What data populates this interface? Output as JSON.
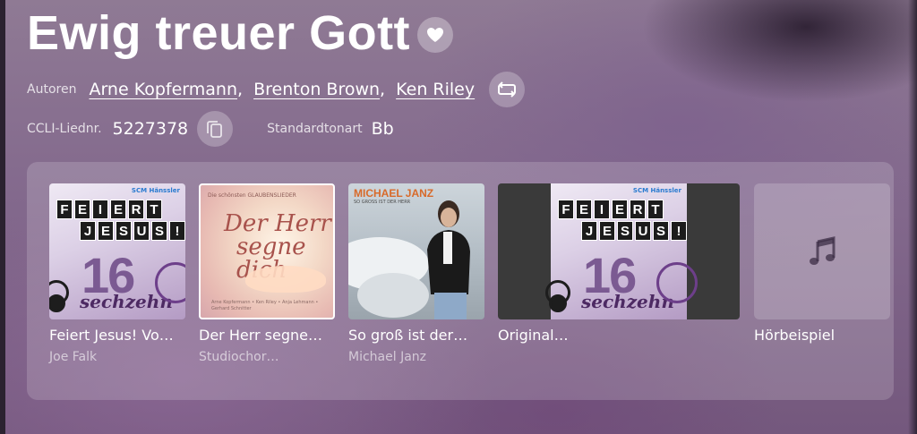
{
  "song": {
    "title": "Ewig treuer Gott",
    "authors_label": "Autoren",
    "authors": [
      "Arne Kopfermann",
      "Brenton Brown",
      "Ken Riley"
    ],
    "ccli_label": "CCLI-Liednr.",
    "ccli_number": "5227378",
    "key_label": "Standardtonart",
    "key_value": "Bb"
  },
  "recordings": [
    {
      "title": "Feiert Jesus! Vo…",
      "artist": "Joe Falk"
    },
    {
      "title": "Der Herr segne…",
      "artist": "Studiochor…"
    },
    {
      "title": "So groß ist der…",
      "artist": "Michael Janz"
    },
    {
      "title": "Original…",
      "artist": ""
    },
    {
      "title": "Hörbeispiel",
      "artist": ""
    }
  ],
  "covers": {
    "feiert_jesus": {
      "logo": "SCM Hänssler",
      "line1": "FEIERT",
      "line2": "JESUS!",
      "number": "16",
      "word": "sechzehn"
    },
    "der_herr": {
      "top": "Die schönsten GLAUBENSLIEDER",
      "script1": "Der Herr",
      "script2": "segne dich",
      "small": "Arne Kopfermann • Ken Riley • Anja Lehmann • Gerhard Schnitter"
    },
    "michael_janz": {
      "name": "MICHAEL JANZ",
      "subtitle": "SO GROSS IST DER HERR"
    }
  },
  "icons": {
    "favorite": "heart-icon",
    "repeat": "repeat-icon",
    "copy": "copy-icon",
    "audio": "music-note-icon"
  },
  "colors": {
    "accent": "#ffffff",
    "panel": "rgba(255,255,255,0.17)"
  }
}
